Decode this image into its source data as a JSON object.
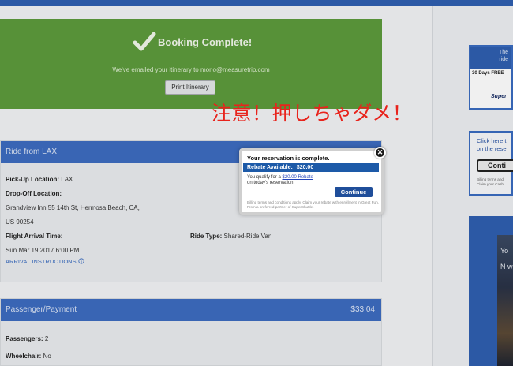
{
  "booking": {
    "title": "Booking Complete!",
    "subtitle": "We've emailed your itinerary to morio@measuretrip.com",
    "print_label": "Print Itinerary"
  },
  "annotation": {
    "warning_text": "注意！押しちゃダメ！"
  },
  "ride": {
    "header": "Ride from LAX",
    "pickup_label": "Pick-Up Location:",
    "pickup_value": "LAX",
    "dropoff_label": "Drop-Off Location:",
    "dropoff_line1": "Grandview Inn 55 14th St, Hermosa Beach, CA,",
    "dropoff_line2": "US 90254",
    "arrival_label": "Flight Arrival Time:",
    "arrival_value": "Sun Mar 19 2017 6:00 PM",
    "arrival_link": "ARRIVAL INSTRUCTIONS",
    "ride_type_label": "Ride Type:",
    "ride_type_value": "Shared-Ride Van"
  },
  "payment": {
    "header": "Passenger/Payment",
    "amount": "$33.04",
    "passengers_label": "Passengers:",
    "passengers_value": "2",
    "wheelchair_label": "Wheelchair:",
    "wheelchair_value": "No"
  },
  "modal": {
    "title": "Your reservation is complete.",
    "rebate_label": "Rebate Available:",
    "rebate_amount": "$20.00",
    "qualify_prefix": "You qualify for a",
    "qualify_link": "$20.00 Rebate",
    "qualify_suffix": "on today's reservation",
    "continue_label": "Continue",
    "fine_print": "Billing terms and conditions apply. Claim your rebate with enrollment in Great Fun. From a preferred partner of SuperShuttle.",
    "close_symbol": "✕"
  },
  "sidebar": {
    "ad1_line1": "The",
    "ad1_line2": "ride",
    "ad1_offer": "30 Days FREE",
    "ad1_logo": "Super",
    "ad2_line1": "Click here t",
    "ad2_line2": "on the rese",
    "ad2_button": "Conti",
    "ad2_fine1": "Billing terms and",
    "ad2_fine2": "Claim your Cash",
    "ad3_text": "Yo N w"
  },
  "colors": {
    "brand_blue": "#3d6cc0",
    "success_green": "#5d9b3c",
    "warning_red": "#e8231c",
    "modal_bar": "#1d5aa8"
  }
}
